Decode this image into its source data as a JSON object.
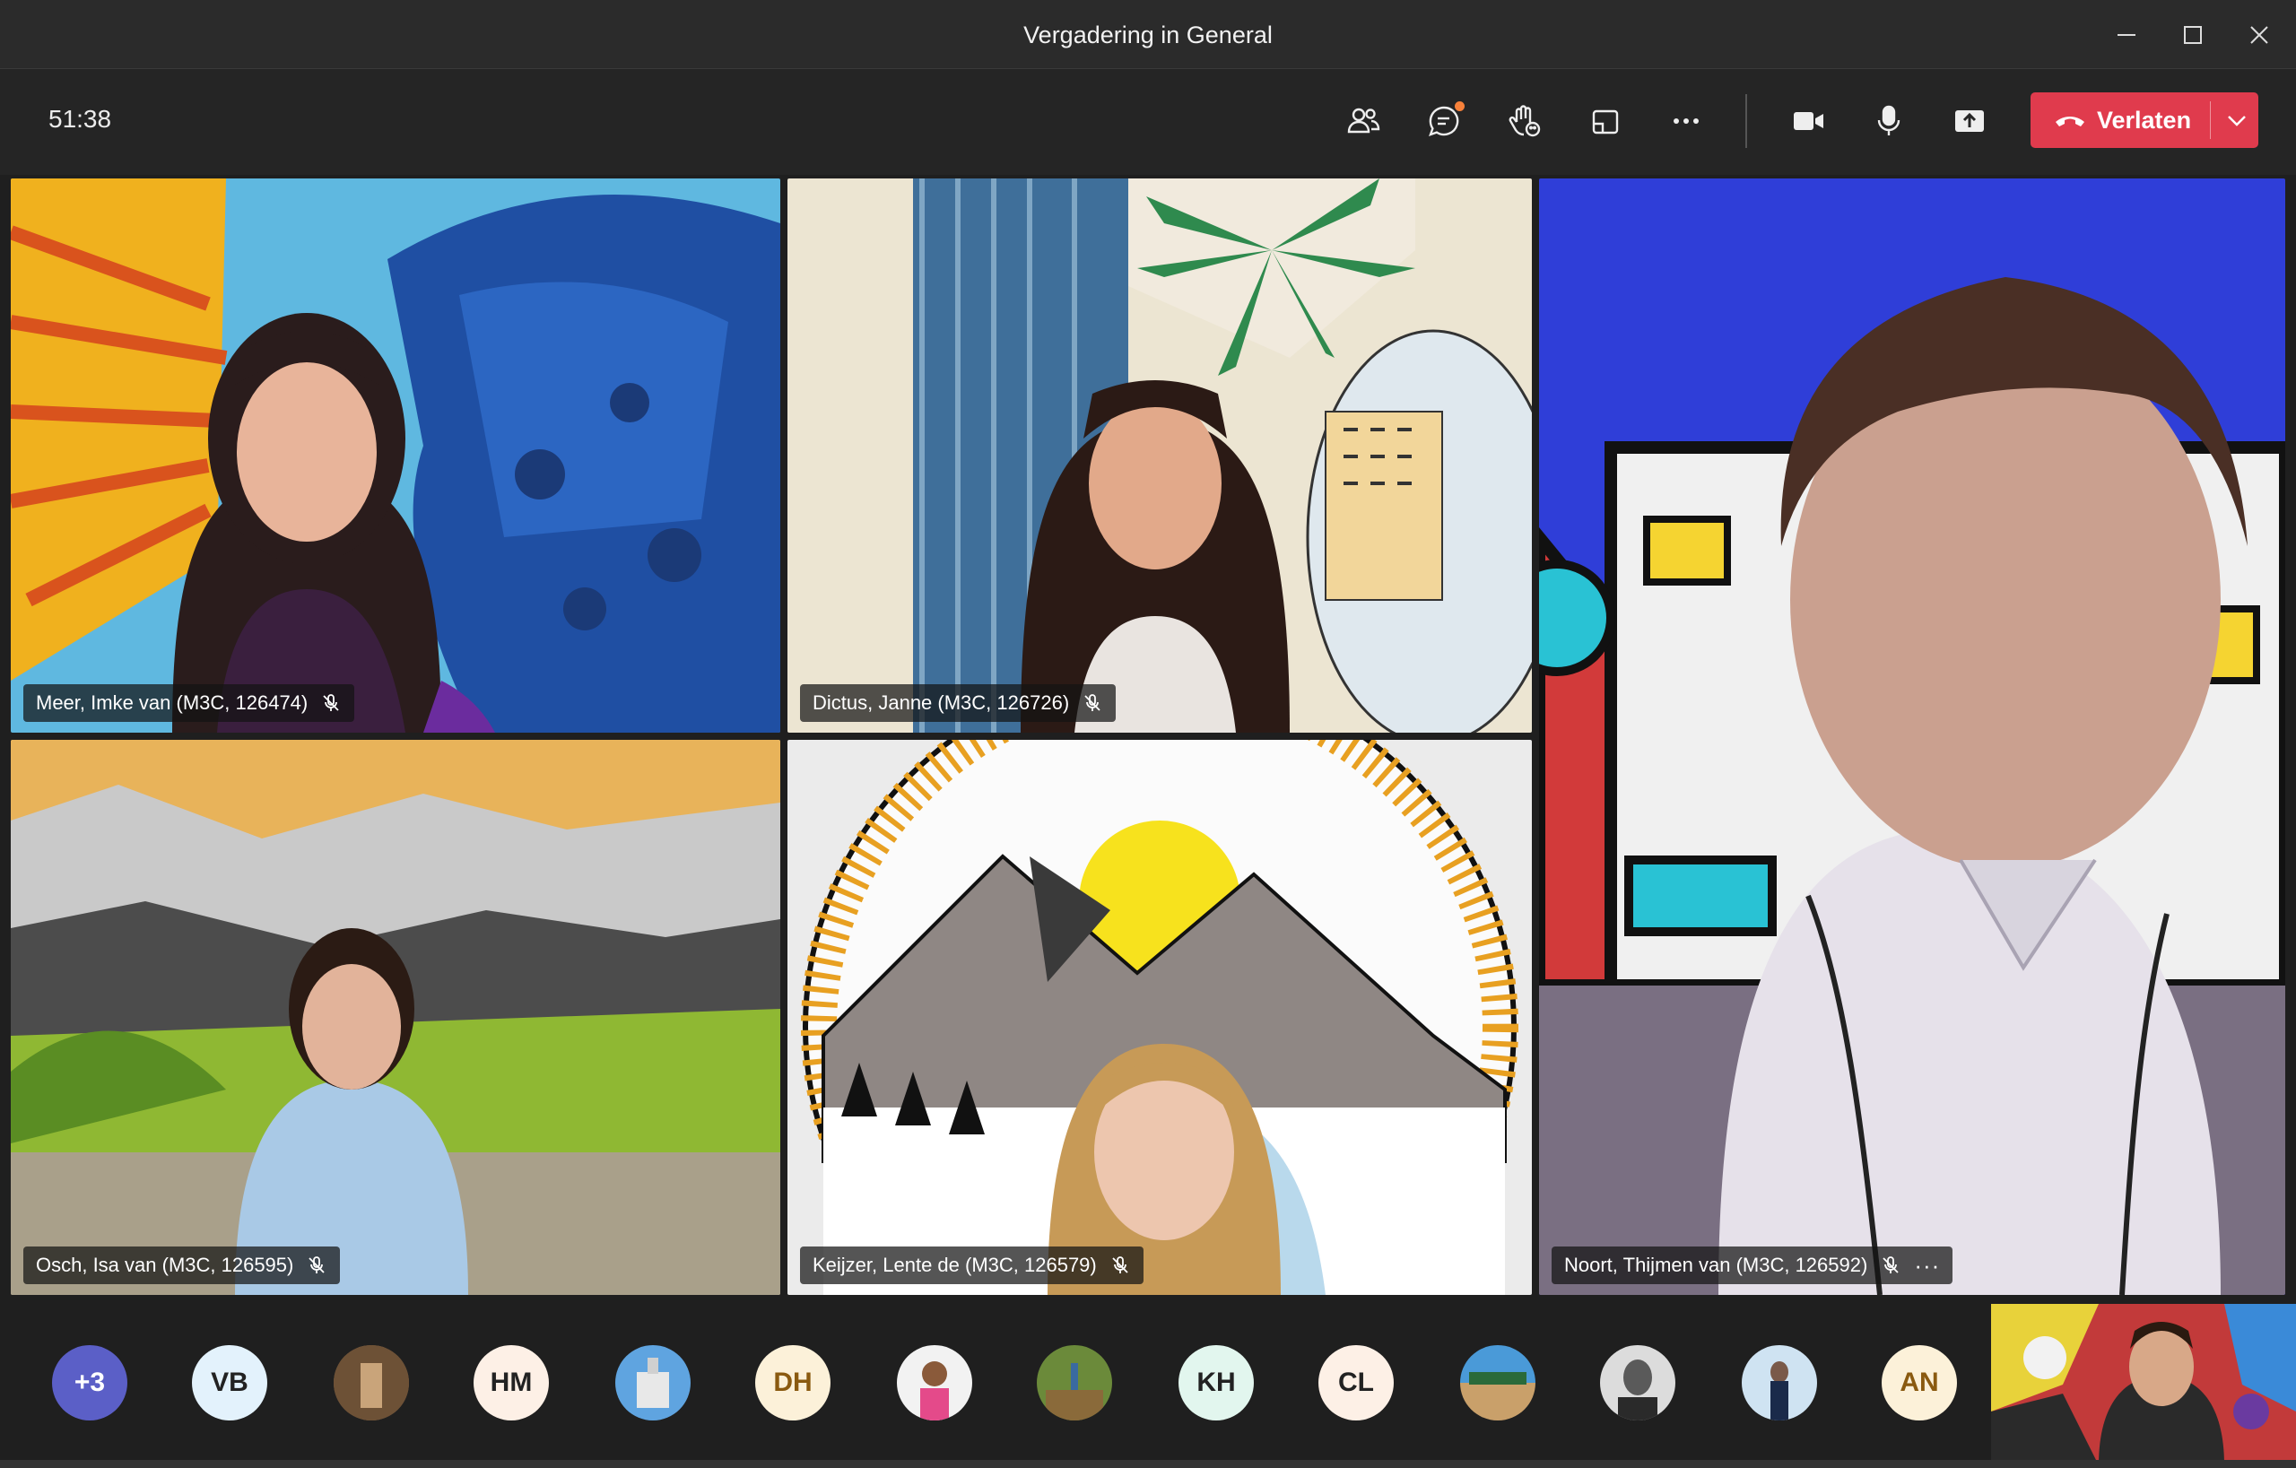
{
  "window": {
    "title": "Vergadering in General",
    "controls": [
      "minimize-icon",
      "maximize-icon",
      "close-icon"
    ]
  },
  "toolbar": {
    "timer": "51:38",
    "buttons": [
      "people-icon",
      "chat-icon",
      "reactions-icon",
      "share-tray-icon",
      "more-icon",
      "camera-icon",
      "microphone-icon",
      "share-screen-icon"
    ],
    "leave_label": "Verlaten"
  },
  "colors": {
    "leave": "#e03b4d",
    "chat_badge": "#f7813a",
    "avatar_plus": "#5b5fc7"
  },
  "participants": [
    {
      "name": "Meer, Imke van (M3C, 126474)",
      "muted": true
    },
    {
      "name": "Dictus, Janne (M3C, 126726)",
      "muted": true
    },
    {
      "name": "Noort, Thijmen van (M3C, 126592)",
      "muted": true
    },
    {
      "name": "Osch, Isa van (M3C, 126595)",
      "muted": true
    },
    {
      "name": "Keijzer, Lente de (M3C, 126579)",
      "muted": true
    }
  ],
  "more_label": "···",
  "avatars": [
    {
      "label": "+3"
    },
    {
      "label": "VB"
    },
    {
      "label": ""
    },
    {
      "label": "HM"
    },
    {
      "label": ""
    },
    {
      "label": "DH"
    },
    {
      "label": ""
    },
    {
      "label": ""
    },
    {
      "label": "KH"
    },
    {
      "label": "CL"
    },
    {
      "label": ""
    },
    {
      "label": ""
    },
    {
      "label": ""
    },
    {
      "label": "AN"
    }
  ]
}
